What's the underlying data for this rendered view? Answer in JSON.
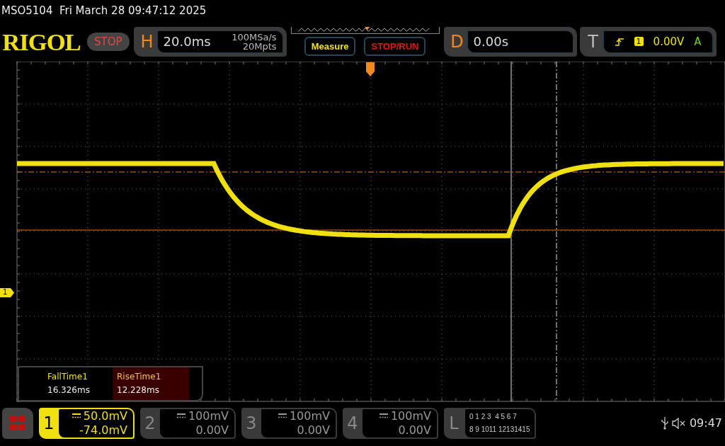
{
  "status_line": "MSO5104  Fri March 28 09:47:12 2025",
  "logo": "RIGOL",
  "run_state": "STOP",
  "horizontal": {
    "label": "H",
    "timebase": "20.0ms",
    "sample_rate": "100MSa/s",
    "memory_depth": "20Mpts"
  },
  "buttons": [
    {
      "label": "Measure",
      "kind": "measure"
    },
    {
      "label": "STOP/RUN",
      "kind": "run"
    }
  ],
  "delay": {
    "label": "D",
    "value": "0.00s"
  },
  "trigger": {
    "label": "T",
    "source": "1",
    "level": "0.00V",
    "mode": "A"
  },
  "channel_marker": "1",
  "measurements": [
    {
      "label": "FallTime1",
      "value": "16.326ms",
      "selected": false
    },
    {
      "label": "RiseTime1",
      "value": "12.228ms",
      "selected": true
    }
  ],
  "channels": [
    {
      "number": "1",
      "scale": "50.0mV",
      "offset": "-74.0mV",
      "active": true
    },
    {
      "number": "2",
      "scale": "100mV",
      "offset": "0.00V",
      "active": false
    },
    {
      "number": "3",
      "scale": "100mV",
      "offset": "0.00V",
      "active": false
    },
    {
      "number": "4",
      "scale": "100mV",
      "offset": "0.00V",
      "active": false
    }
  ],
  "logic": {
    "label": "L",
    "row_1": "0 1 2 3  4 5 6 7",
    "row_2": "8 9 1011 12131415"
  },
  "clock": "09:47"
}
